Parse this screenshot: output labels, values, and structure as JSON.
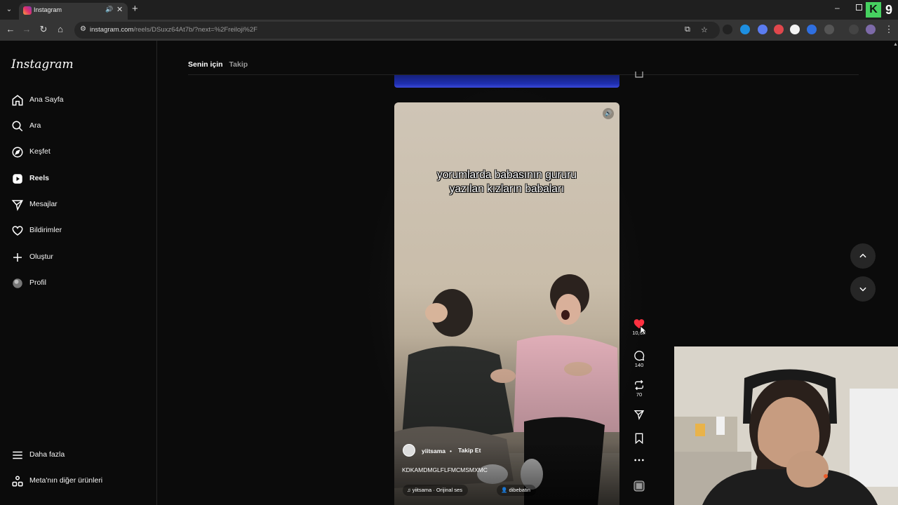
{
  "browser": {
    "tab_title": "Instagram",
    "url_host": "instagram.com",
    "url_path": "/reels/DSuxz64At7b/?next=%2Freiloji%2F"
  },
  "sidebar": {
    "logo": "Instagram",
    "items": [
      {
        "label": "Ana Sayfa",
        "icon": "home-icon"
      },
      {
        "label": "Ara",
        "icon": "search-icon"
      },
      {
        "label": "Keşfet",
        "icon": "compass-icon"
      },
      {
        "label": "Reels",
        "icon": "reels-icon"
      },
      {
        "label": "Mesajlar",
        "icon": "send-icon"
      },
      {
        "label": "Bildirimler",
        "icon": "heart-icon"
      },
      {
        "label": "Oluştur",
        "icon": "plus-icon"
      },
      {
        "label": "Profil",
        "icon": "avatar"
      }
    ],
    "bottom_items": [
      {
        "label": "Daha fazla",
        "icon": "menu-icon"
      },
      {
        "label": "Meta'nın diğer ürünleri",
        "icon": "meta-products-icon"
      }
    ]
  },
  "feed_tabs": {
    "active": "Senin için",
    "other": "Takip"
  },
  "reel": {
    "caption_overlay_line1": "yorumlarda babasının gururu",
    "caption_overlay_line2": "yazılan kızların babaları",
    "username": "yiitsama",
    "separator": "•",
    "follow_label": "Takip Et",
    "description": "KDKAMDMGLFLFMCMSMXMC",
    "audio": "yiitsama · Orijinal ses",
    "tagged_user": "dibebatin"
  },
  "actions": {
    "likes": "10,0B",
    "comments": "140",
    "reposts": "70"
  },
  "colors": {
    "like_active": "#ff3040",
    "background": "#0b0b0b",
    "accent_green": "#46d160"
  }
}
